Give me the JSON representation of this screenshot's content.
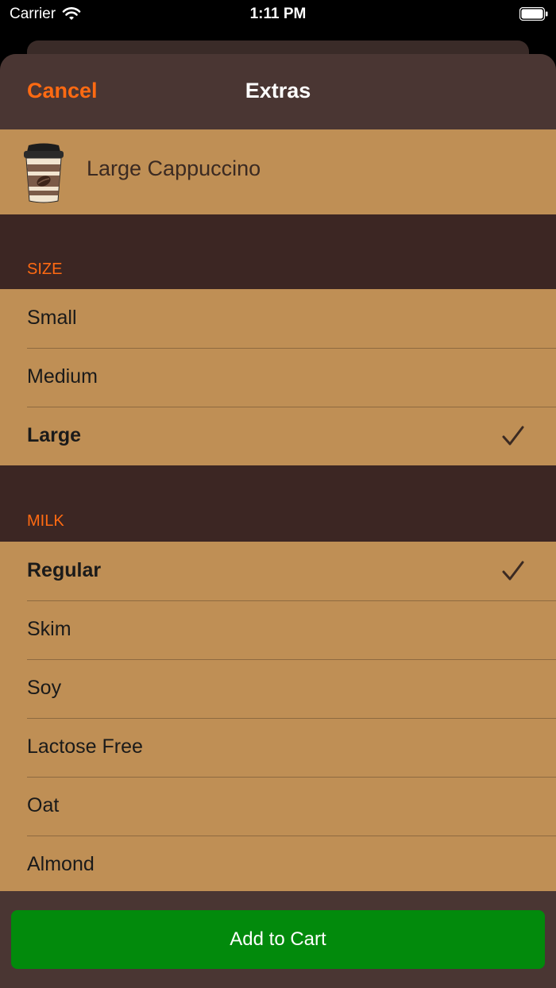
{
  "status_bar": {
    "carrier": "Carrier",
    "time": "1:11 PM"
  },
  "nav": {
    "cancel_label": "Cancel",
    "title": "Extras"
  },
  "product": {
    "name": "Large Cappuccino",
    "icon": "coffee-cup-icon"
  },
  "sections": {
    "size": {
      "header": "SIZE",
      "options": [
        {
          "label": "Small",
          "selected": false
        },
        {
          "label": "Medium",
          "selected": false
        },
        {
          "label": "Large",
          "selected": true
        }
      ]
    },
    "milk": {
      "header": "MILK",
      "options": [
        {
          "label": "Regular",
          "selected": true
        },
        {
          "label": "Skim",
          "selected": false
        },
        {
          "label": "Soy",
          "selected": false
        },
        {
          "label": "Lactose Free",
          "selected": false
        },
        {
          "label": "Oat",
          "selected": false
        },
        {
          "label": "Almond",
          "selected": false
        }
      ]
    }
  },
  "footer": {
    "add_to_cart_label": "Add to Cart"
  },
  "colors": {
    "accent": "#ff6a12",
    "row_background": "#bf8f55",
    "sheet_background": "#3c2623",
    "nav_background": "#4a3633",
    "button_green": "#028a0c"
  }
}
